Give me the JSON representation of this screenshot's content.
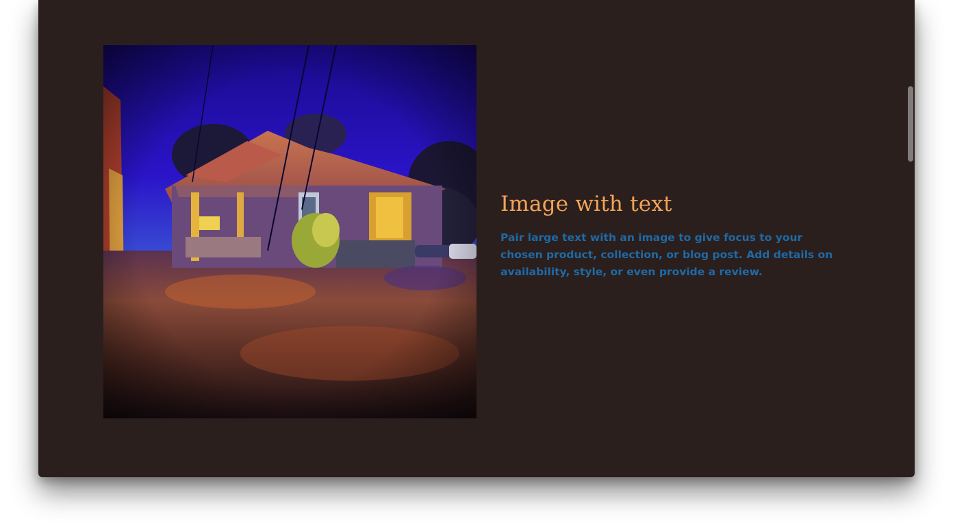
{
  "section": {
    "heading": "Image with text",
    "body": "Pair large text with an image to give focus to your chosen product, collection, or blog post. Add details on availability, style, or even provide a review.",
    "image_description": "house-photo"
  },
  "colors": {
    "background": "#2a1f1d",
    "heading": "#f4a456",
    "body": "#1f6aa6"
  }
}
